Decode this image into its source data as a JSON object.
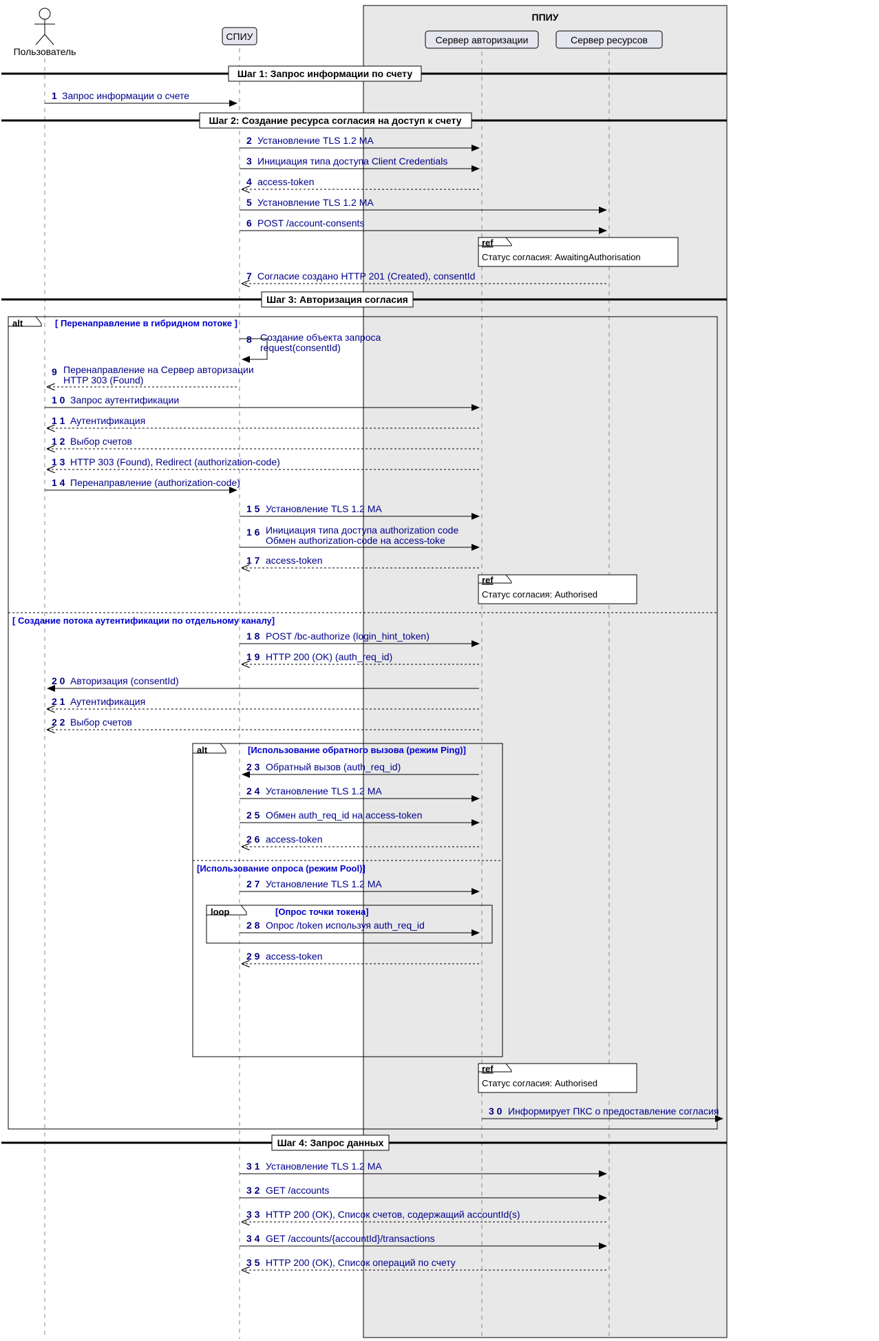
{
  "participants": {
    "user": "Пользователь",
    "spiu": "СПИУ",
    "ppiu": "ППИУ",
    "auth": "Сервер авторизации",
    "res": "Сервер ресурсов"
  },
  "steps": {
    "s1": "Шаг 1: Запрос информации по счету",
    "s2": "Шаг 2: Создание ресурса согласия на доступ к счету",
    "s3": "Шаг 3: Авторизация согласия",
    "s4": "Шаг 4: Запрос данных"
  },
  "frames": {
    "alt": "alt",
    "loop": "loop",
    "ref": "ref",
    "hybrid": "[ Перенаправление в гибридном потоке ]",
    "decoupled": "[ Создание потока аутентификации по отдельному каналу]",
    "ping": "[Использование обратного вызова (режим Ping)]",
    "pool": "[Использование опроса (режим Pool)]",
    "tokpoll": "[Опрос точки токена]",
    "r1": "Статус согласия: AwaitingAuthorisation",
    "r2": "Статус согласия: Authorised",
    "r3": "Статус согласия: Authorised"
  },
  "m": {
    "1": "Запрос информации о счете",
    "2": "Установление TLS 1.2 MA",
    "3": "Инициация типа доступа Client Credentials",
    "4": "access-token",
    "5": "Установление TLS 1.2 MA",
    "6": "POST /account-consents",
    "7": "Согласие создано HTTP 201 (Created), consentId",
    "8a": "Создание объекта запроса",
    "8b": "request(consentId)",
    "9a": "Перенаправление на Сервер авторизации",
    "9b": "HTTP 303 (Found)",
    "10": "Запрос аутентификации",
    "11": "Аутентификация",
    "12": "Выбор счетов",
    "13": "HTTP 303 (Found), Redirect (authorization-code)",
    "14": "Перенаправление (authorization-code)",
    "15": "Установление TLS 1.2 MA",
    "16a": "Инициация типа доступа authorization code",
    "16b": "Обмен authorization-code на access-toke",
    "17": "access-token",
    "18": "POST /bc-authorize (login_hint_token)",
    "19": "HTTP 200 (OK) (auth_req_id)",
    "20": "Авторизация (consentId)",
    "21": "Аутентификация",
    "22": "Выбор счетов",
    "23": "Обратный вызов (auth_req_id)",
    "24": "Установление TLS 1.2 MA",
    "25": "Обмен auth_req_id на access-token",
    "26": "access-token",
    "27": "Установление TLS 1.2 MA",
    "28": "Опрос /token используя auth_req_id",
    "29": "access-token",
    "30": "Информирует ПКС о предоставление согласия",
    "31": "Установление TLS 1.2 MA",
    "32": "GET /accounts",
    "33": "HTTP 200 (OK), Список счетов, содержащий accountId(s)",
    "34": "GET /accounts/{accountId}/transactions",
    "35": "HTTP 200 (OK), Список операций по счету"
  },
  "n": {
    "1": "1",
    "2": "2",
    "3": "3",
    "4": "4",
    "5": "5",
    "6": "6",
    "7": "7",
    "8": "8",
    "9": "9",
    "10": "1 0",
    "11": "1 1",
    "12": "1 2",
    "13": "1 3",
    "14": "1 4",
    "15": "1 5",
    "16": "1 6",
    "17": "1 7",
    "18": "1 8",
    "19": "1 9",
    "20": "2 0",
    "21": "2 1",
    "22": "2 2",
    "23": "2 3",
    "24": "2 4",
    "25": "2 5",
    "26": "2 6",
    "27": "2 7",
    "28": "2 8",
    "29": "2 9",
    "30": "3 0",
    "31": "3 1",
    "32": "3 2",
    "33": "3 3",
    "34": "3 4",
    "35": "3 5"
  }
}
